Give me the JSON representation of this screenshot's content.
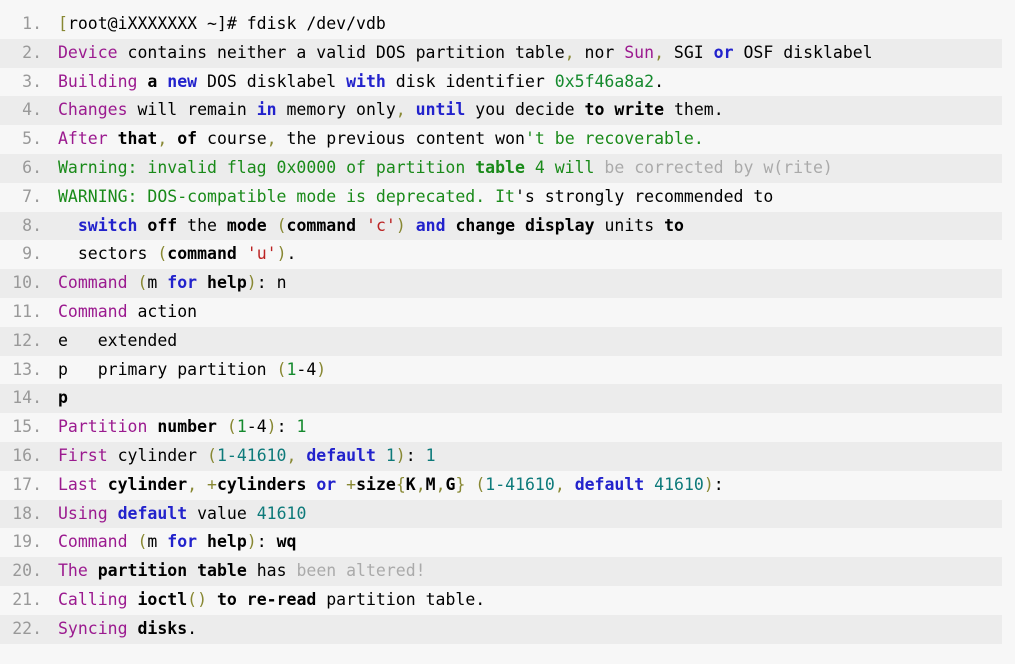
{
  "view": {
    "kind": "syntax-highlighted-code-block",
    "language": "shell-session",
    "background_color": "#f7f7f7",
    "alt_row_color": "#ececec",
    "line_number_color": "#999999",
    "total_lines": 22
  },
  "palette": {
    "plain": "#000000",
    "identifier_purple": "#9b1a8f",
    "keyword_blue": "#2222cc",
    "number_teal": "#0d7a7a",
    "number_green": "#158a2e",
    "string_red": "#bb2222",
    "punctuation_olive": "#888833",
    "comment_green": "#198a19",
    "dim_gray": "#aaaaaa"
  },
  "lines": [
    {
      "number": "1",
      "plain_text": "[root@iXXXXXXX ~]# fdisk /dev/vdb",
      "tokens": [
        {
          "t": "[",
          "c": "t-punc"
        },
        {
          "t": "root@iXXXXXXX ~]# fdisk /dev/vdb",
          "c": "t-plain"
        }
      ]
    },
    {
      "number": "2",
      "plain_text": "Device contains neither a valid DOS partition table, nor Sun, SGI or OSF disklabel",
      "tokens": [
        {
          "t": "Device",
          "c": "t-name"
        },
        {
          "t": " contains neither a valid DOS partition table",
          "c": "t-plain"
        },
        {
          "t": ",",
          "c": "t-punc"
        },
        {
          "t": " nor ",
          "c": "t-plain"
        },
        {
          "t": "Sun",
          "c": "t-name"
        },
        {
          "t": ",",
          "c": "t-punc"
        },
        {
          "t": " SGI ",
          "c": "t-plain"
        },
        {
          "t": "or",
          "c": "t-kw"
        },
        {
          "t": " OSF disklabel",
          "c": "t-plain"
        }
      ]
    },
    {
      "number": "3",
      "plain_text": "Building a new DOS disklabel with disk identifier 0x5f46a8a2.",
      "tokens": [
        {
          "t": "Building",
          "c": "t-name"
        },
        {
          "t": " ",
          "c": "t-plain"
        },
        {
          "t": "a",
          "c": "t-bold"
        },
        {
          "t": " ",
          "c": "t-plain"
        },
        {
          "t": "new",
          "c": "t-kw"
        },
        {
          "t": " DOS disklabel ",
          "c": "t-plain"
        },
        {
          "t": "with",
          "c": "t-kw"
        },
        {
          "t": " disk identifier ",
          "c": "t-plain"
        },
        {
          "t": "0x5f46a8a2",
          "c": "t-numg"
        },
        {
          "t": ".",
          "c": "t-plain"
        }
      ]
    },
    {
      "number": "4",
      "plain_text": "Changes will remain in memory only, until you decide to write them.",
      "tokens": [
        {
          "t": "Changes",
          "c": "t-name"
        },
        {
          "t": " will remain ",
          "c": "t-plain"
        },
        {
          "t": "in",
          "c": "t-kw"
        },
        {
          "t": " memory only",
          "c": "t-plain"
        },
        {
          "t": ",",
          "c": "t-punc"
        },
        {
          "t": " ",
          "c": "t-plain"
        },
        {
          "t": "until",
          "c": "t-kw"
        },
        {
          "t": " you decide ",
          "c": "t-plain"
        },
        {
          "t": "to write",
          "c": "t-bold"
        },
        {
          "t": " them.",
          "c": "t-plain"
        }
      ]
    },
    {
      "number": "5",
      "plain_text": "After that, of course, the previous content won't be recoverable.",
      "tokens": [
        {
          "t": "After",
          "c": "t-name"
        },
        {
          "t": " ",
          "c": "t-plain"
        },
        {
          "t": "that",
          "c": "t-bold"
        },
        {
          "t": ",",
          "c": "t-punc"
        },
        {
          "t": " ",
          "c": "t-plain"
        },
        {
          "t": "of",
          "c": "t-bold"
        },
        {
          "t": " course",
          "c": "t-plain"
        },
        {
          "t": ",",
          "c": "t-punc"
        },
        {
          "t": " the previous content won",
          "c": "t-plain"
        },
        {
          "t": "'t be recoverable.",
          "c": "t-comment"
        }
      ]
    },
    {
      "number": "6",
      "plain_text": "Warning: invalid flag 0x0000 of partition table 4 will be corrected by w(rite)",
      "tokens": [
        {
          "t": "Warning: invalid flag 0x0000 of partition ",
          "c": "t-comment"
        },
        {
          "t": "table",
          "c": "t-greenb"
        },
        {
          "t": " 4 will",
          "c": "t-comment"
        },
        {
          "t": " be corrected by w(rite)",
          "c": "t-gray"
        }
      ]
    },
    {
      "number": "7",
      "plain_text": "WARNING: DOS-compatible mode is deprecated. It's strongly recommended to",
      "tokens": [
        {
          "t": "WARNING: DOS-compatible mode is deprecated",
          "c": "t-comment"
        },
        {
          "t": ". It",
          "c": "t-comment"
        },
        {
          "t": "'s strongly recommended to",
          "c": "t-plain"
        }
      ]
    },
    {
      "number": "8",
      "plain_text": "  switch off the mode (command 'c') and change display units to",
      "tokens": [
        {
          "t": "  ",
          "c": "t-plain"
        },
        {
          "t": "switch",
          "c": "t-kw"
        },
        {
          "t": " ",
          "c": "t-plain"
        },
        {
          "t": "off",
          "c": "t-bold"
        },
        {
          "t": " the ",
          "c": "t-plain"
        },
        {
          "t": "mode",
          "c": "t-bold"
        },
        {
          "t": " (",
          "c": "t-punc"
        },
        {
          "t": "command",
          "c": "t-bold"
        },
        {
          "t": " ",
          "c": "t-plain"
        },
        {
          "t": "'c'",
          "c": "t-str"
        },
        {
          "t": ")",
          "c": "t-punc"
        },
        {
          "t": " ",
          "c": "t-plain"
        },
        {
          "t": "and",
          "c": "t-kw"
        },
        {
          "t": " ",
          "c": "t-plain"
        },
        {
          "t": "change display",
          "c": "t-bold"
        },
        {
          "t": " units ",
          "c": "t-plain"
        },
        {
          "t": "to",
          "c": "t-bold"
        }
      ]
    },
    {
      "number": "9",
      "plain_text": "  sectors (command 'u').",
      "tokens": [
        {
          "t": "  sectors ",
          "c": "t-plain"
        },
        {
          "t": "(",
          "c": "t-punc"
        },
        {
          "t": "command",
          "c": "t-bold"
        },
        {
          "t": " ",
          "c": "t-plain"
        },
        {
          "t": "'u'",
          "c": "t-str"
        },
        {
          "t": ")",
          "c": "t-punc"
        },
        {
          "t": ".",
          "c": "t-plain"
        }
      ]
    },
    {
      "number": "10",
      "plain_text": "Command (m for help): n",
      "tokens": [
        {
          "t": "Command",
          "c": "t-name"
        },
        {
          "t": " ",
          "c": "t-plain"
        },
        {
          "t": "(",
          "c": "t-punc"
        },
        {
          "t": "m ",
          "c": "t-plain"
        },
        {
          "t": "for",
          "c": "t-kw"
        },
        {
          "t": " ",
          "c": "t-plain"
        },
        {
          "t": "help",
          "c": "t-bold"
        },
        {
          "t": ")",
          "c": "t-punc"
        },
        {
          "t": ": n",
          "c": "t-plain"
        }
      ]
    },
    {
      "number": "11",
      "plain_text": "Command action",
      "tokens": [
        {
          "t": "Command",
          "c": "t-name"
        },
        {
          "t": " action",
          "c": "t-plain"
        }
      ]
    },
    {
      "number": "12",
      "plain_text": "e   extended",
      "tokens": [
        {
          "t": "e   extended",
          "c": "t-plain"
        }
      ]
    },
    {
      "number": "13",
      "plain_text": "p   primary partition (1-4)",
      "tokens": [
        {
          "t": "p   primary partition ",
          "c": "t-plain"
        },
        {
          "t": "(",
          "c": "t-punc"
        },
        {
          "t": "1",
          "c": "t-numg"
        },
        {
          "t": "-4",
          "c": "t-plain"
        },
        {
          "t": ")",
          "c": "t-punc"
        }
      ]
    },
    {
      "number": "14",
      "plain_text": "p",
      "tokens": [
        {
          "t": "p",
          "c": "t-bold"
        }
      ]
    },
    {
      "number": "15",
      "plain_text": "Partition number (1-4): 1",
      "tokens": [
        {
          "t": "Partition",
          "c": "t-name"
        },
        {
          "t": " ",
          "c": "t-plain"
        },
        {
          "t": "number",
          "c": "t-bold"
        },
        {
          "t": " ",
          "c": "t-plain"
        },
        {
          "t": "(",
          "c": "t-punc"
        },
        {
          "t": "1",
          "c": "t-numg"
        },
        {
          "t": "-4",
          "c": "t-plain"
        },
        {
          "t": ")",
          "c": "t-punc"
        },
        {
          "t": ": ",
          "c": "t-plain"
        },
        {
          "t": "1",
          "c": "t-numg"
        }
      ]
    },
    {
      "number": "16",
      "plain_text": "First cylinder (1-41610, default 1): 1",
      "tokens": [
        {
          "t": "First",
          "c": "t-name"
        },
        {
          "t": " cylinder ",
          "c": "t-plain"
        },
        {
          "t": "(",
          "c": "t-punc"
        },
        {
          "t": "1-41610",
          "c": "t-num"
        },
        {
          "t": ",",
          "c": "t-punc"
        },
        {
          "t": " ",
          "c": "t-plain"
        },
        {
          "t": "default",
          "c": "t-kw"
        },
        {
          "t": " ",
          "c": "t-plain"
        },
        {
          "t": "1",
          "c": "t-num"
        },
        {
          "t": ")",
          "c": "t-punc"
        },
        {
          "t": ": ",
          "c": "t-plain"
        },
        {
          "t": "1",
          "c": "t-num"
        }
      ]
    },
    {
      "number": "17",
      "plain_text": "Last cylinder, +cylinders or +size{K,M,G} (1-41610, default 41610):",
      "tokens": [
        {
          "t": "Last",
          "c": "t-name"
        },
        {
          "t": " ",
          "c": "t-plain"
        },
        {
          "t": "cylinder",
          "c": "t-bold"
        },
        {
          "t": ",",
          "c": "t-punc"
        },
        {
          "t": " ",
          "c": "t-plain"
        },
        {
          "t": "+",
          "c": "t-punc"
        },
        {
          "t": "cylinders",
          "c": "t-bold"
        },
        {
          "t": " ",
          "c": "t-plain"
        },
        {
          "t": "or",
          "c": "t-kw"
        },
        {
          "t": " ",
          "c": "t-plain"
        },
        {
          "t": "+",
          "c": "t-punc"
        },
        {
          "t": "size",
          "c": "t-bold"
        },
        {
          "t": "{",
          "c": "t-punc"
        },
        {
          "t": "K",
          "c": "t-bold"
        },
        {
          "t": ",",
          "c": "t-punc"
        },
        {
          "t": "M",
          "c": "t-bold"
        },
        {
          "t": ",",
          "c": "t-punc"
        },
        {
          "t": "G",
          "c": "t-bold"
        },
        {
          "t": "}",
          "c": "t-punc"
        },
        {
          "t": " ",
          "c": "t-plain"
        },
        {
          "t": "(",
          "c": "t-punc"
        },
        {
          "t": "1-41610",
          "c": "t-num"
        },
        {
          "t": ",",
          "c": "t-punc"
        },
        {
          "t": " ",
          "c": "t-plain"
        },
        {
          "t": "default",
          "c": "t-kw"
        },
        {
          "t": " ",
          "c": "t-plain"
        },
        {
          "t": "41610",
          "c": "t-num"
        },
        {
          "t": ")",
          "c": "t-punc"
        },
        {
          "t": ":",
          "c": "t-plain"
        }
      ]
    },
    {
      "number": "18",
      "plain_text": "Using default value 41610",
      "tokens": [
        {
          "t": "Using",
          "c": "t-name"
        },
        {
          "t": " ",
          "c": "t-plain"
        },
        {
          "t": "default",
          "c": "t-kw"
        },
        {
          "t": " value ",
          "c": "t-plain"
        },
        {
          "t": "41610",
          "c": "t-num"
        }
      ]
    },
    {
      "number": "19",
      "plain_text": "Command (m for help): wq",
      "tokens": [
        {
          "t": "Command",
          "c": "t-name"
        },
        {
          "t": " ",
          "c": "t-plain"
        },
        {
          "t": "(",
          "c": "t-punc"
        },
        {
          "t": "m ",
          "c": "t-plain"
        },
        {
          "t": "for",
          "c": "t-kw"
        },
        {
          "t": " ",
          "c": "t-plain"
        },
        {
          "t": "help",
          "c": "t-bold"
        },
        {
          "t": ")",
          "c": "t-punc"
        },
        {
          "t": ": ",
          "c": "t-plain"
        },
        {
          "t": "wq",
          "c": "t-bold"
        }
      ]
    },
    {
      "number": "20",
      "plain_text": "The partition table has been altered!",
      "tokens": [
        {
          "t": "The",
          "c": "t-name"
        },
        {
          "t": " ",
          "c": "t-plain"
        },
        {
          "t": "partition table",
          "c": "t-bold"
        },
        {
          "t": " has",
          "c": "t-plain"
        },
        {
          "t": " been altered!",
          "c": "t-gray"
        }
      ]
    },
    {
      "number": "21",
      "plain_text": "Calling ioctl() to re-read partition table.",
      "tokens": [
        {
          "t": "Calling",
          "c": "t-name"
        },
        {
          "t": " ",
          "c": "t-plain"
        },
        {
          "t": "ioctl",
          "c": "t-bold"
        },
        {
          "t": "()",
          "c": "t-punc"
        },
        {
          "t": " ",
          "c": "t-plain"
        },
        {
          "t": "to re-read",
          "c": "t-bold"
        },
        {
          "t": " partition table.",
          "c": "t-plain"
        }
      ]
    },
    {
      "number": "22",
      "plain_text": "Syncing disks.",
      "tokens": [
        {
          "t": "Syncing",
          "c": "t-name"
        },
        {
          "t": " ",
          "c": "t-plain"
        },
        {
          "t": "disks",
          "c": "t-bold"
        },
        {
          "t": ".",
          "c": "t-plain"
        }
      ]
    }
  ]
}
